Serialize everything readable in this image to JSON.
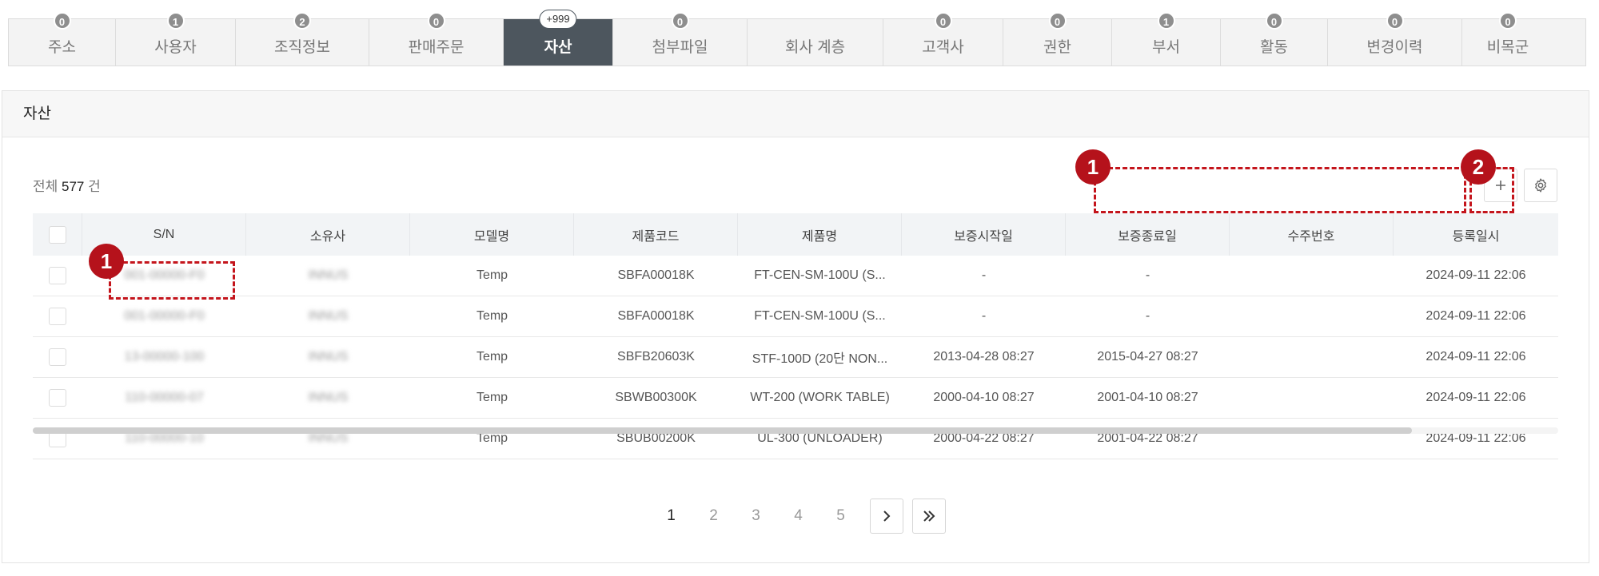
{
  "tabs": [
    {
      "label": "주소",
      "badge": "0"
    },
    {
      "label": "사용자",
      "badge": "1"
    },
    {
      "label": "조직정보",
      "badge": "2"
    },
    {
      "label": "판매주문",
      "badge": "0"
    },
    {
      "label": "자산",
      "badge": "+999",
      "active": true
    },
    {
      "label": "첨부파일",
      "badge": "0"
    },
    {
      "label": "회사 계층",
      "badge": ""
    },
    {
      "label": "고객사",
      "badge": "0"
    },
    {
      "label": "권한",
      "badge": "0"
    },
    {
      "label": "부서",
      "badge": "1"
    },
    {
      "label": "활동",
      "badge": "0"
    },
    {
      "label": "변경이력",
      "badge": "0"
    },
    {
      "label": "비목군",
      "badge": "0"
    }
  ],
  "panel": {
    "title": "자산",
    "total_prefix": "전체",
    "total_count": "577",
    "total_suffix": "건"
  },
  "toolbar": {
    "add_icon": "plus-icon",
    "settings_icon": "gear-icon"
  },
  "table": {
    "columns": [
      "S/N",
      "소유사",
      "모델명",
      "제품코드",
      "제품명",
      "보증시작일",
      "보증종료일",
      "수주번호",
      "등록일시"
    ],
    "rows": [
      {
        "sn": "001-00000-F0",
        "owner": "INNUS",
        "model": "Temp",
        "code": "SBFA00018K",
        "name": "FT-CEN-SM-100U (S...",
        "warranty_start": "-",
        "warranty_end": "-",
        "order_no": "",
        "registered": "2024-09-11 22:06"
      },
      {
        "sn": "001-00000-F0",
        "owner": "INNUS",
        "model": "Temp",
        "code": "SBFA00018K",
        "name": "FT-CEN-SM-100U (S...",
        "warranty_start": "-",
        "warranty_end": "-",
        "order_no": "",
        "registered": "2024-09-11 22:06"
      },
      {
        "sn": "13-00000-100",
        "owner": "INNUS",
        "model": "Temp",
        "code": "SBFB20603K",
        "name": "STF-100D (20단 NON...",
        "warranty_start": "2013-04-28 08:27",
        "warranty_end": "2015-04-27 08:27",
        "order_no": "",
        "registered": "2024-09-11 22:06"
      },
      {
        "sn": "110-00000-07",
        "owner": "INNUS",
        "model": "Temp",
        "code": "SBWB00300K",
        "name": "WT-200 (WORK TABLE)",
        "warranty_start": "2000-04-10 08:27",
        "warranty_end": "2001-04-10 08:27",
        "order_no": "",
        "registered": "2024-09-11 22:06"
      },
      {
        "sn": "110-00000-10",
        "owner": "INNUS",
        "model": "Temp",
        "code": "SBUB00200K",
        "name": "UL-300 (UNLOADER)",
        "warranty_start": "2000-04-22 08:27",
        "warranty_end": "2001-04-22 08:27",
        "order_no": "",
        "registered": "2024-09-11 22:06"
      }
    ]
  },
  "pagination": {
    "pages": [
      "1",
      "2",
      "3",
      "4",
      "5"
    ],
    "current": "1",
    "next_icon": "chevron-right-icon",
    "last_icon": "double-chevron-right-icon"
  },
  "annotations": {
    "marker_1": "1",
    "marker_2": "2",
    "color": "#c4151c"
  }
}
